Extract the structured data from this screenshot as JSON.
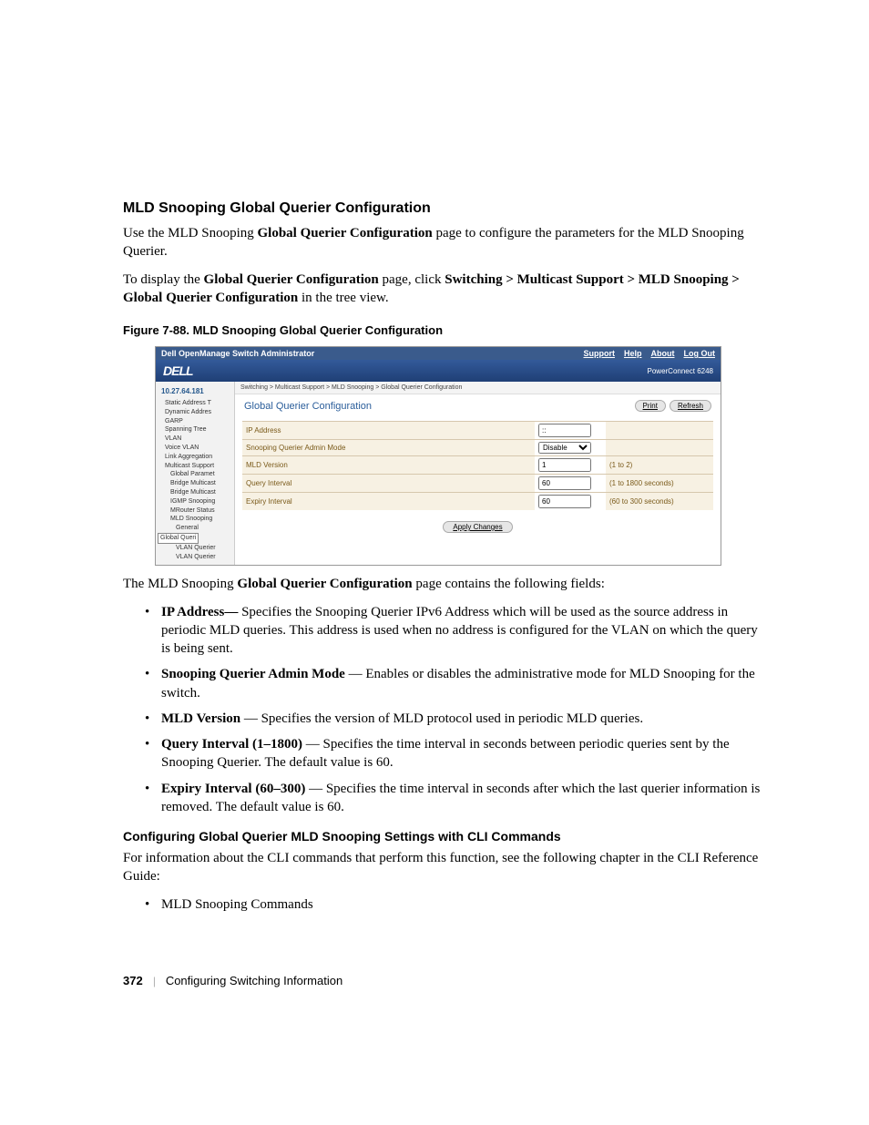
{
  "section": {
    "title": "MLD Snooping Global Querier Configuration",
    "intro_before": "Use the MLD Snooping ",
    "intro_bold": "Global Querier Configuration",
    "intro_after": " page to configure the parameters for the MLD Snooping Querier.",
    "nav_before": "To display the ",
    "nav_bold1": "Global Querier Configuration",
    "nav_mid": " page, click ",
    "nav_bold2": "Switching > Multicast Support > MLD Snooping > Global Querier Configuration",
    "nav_after": " in the tree view."
  },
  "figure": {
    "caption": "Figure 7-88.    MLD Snooping Global Querier Configuration",
    "topbar_title": "Dell OpenManage Switch Administrator",
    "nav": {
      "support": "Support",
      "help": "Help",
      "about": "About",
      "logout": "Log Out"
    },
    "brand": "DELL",
    "model": "PowerConnect 6248",
    "ip": "10.27.64.181",
    "tree": [
      {
        "t": "Static Address T",
        "c": "tn"
      },
      {
        "t": "Dynamic Addres",
        "c": "tn"
      },
      {
        "t": "GARP",
        "c": "tn"
      },
      {
        "t": "Spanning Tree",
        "c": "tn"
      },
      {
        "t": "VLAN",
        "c": "tn"
      },
      {
        "t": "Voice VLAN",
        "c": "tn"
      },
      {
        "t": "Link Aggregation",
        "c": "tn"
      },
      {
        "t": "Multicast Support",
        "c": "tn"
      },
      {
        "t": "Global Paramet",
        "c": "tn l2"
      },
      {
        "t": "Bridge Multicast",
        "c": "tn l2"
      },
      {
        "t": "Bridge Multicast",
        "c": "tn l2"
      },
      {
        "t": "IGMP Snooping",
        "c": "tn l2"
      },
      {
        "t": "MRouter Status",
        "c": "tn l2"
      },
      {
        "t": "MLD Snooping",
        "c": "tn l2"
      },
      {
        "t": "General",
        "c": "tn l3"
      },
      {
        "t": "Global Queri",
        "c": "tn l3 sel"
      },
      {
        "t": "VLAN Querier",
        "c": "tn l3"
      },
      {
        "t": "VLAN Querier",
        "c": "tn l3"
      }
    ],
    "breadcrumb": "Switching > Multicast Support > MLD Snooping > Global Querier Configuration",
    "panel_title": "Global Querier Configuration",
    "print": "Print",
    "refresh": "Refresh",
    "rows": [
      {
        "label": "IP Address",
        "value": "::",
        "range": ""
      },
      {
        "label": "Snooping Querier Admin Mode",
        "value": "Disable",
        "range": "",
        "select": true
      },
      {
        "label": "MLD Version",
        "value": "1",
        "range": "(1 to 2)"
      },
      {
        "label": "Query Interval",
        "value": "60",
        "range": "(1 to 1800 seconds)"
      },
      {
        "label": "Expiry Interval",
        "value": "60",
        "range": "(60 to 300 seconds)"
      }
    ],
    "apply": "Apply Changes"
  },
  "postfig": {
    "lead_before": "The MLD Snooping ",
    "lead_bold": "Global Querier Configuration",
    "lead_after": " page contains the following fields:",
    "items": [
      {
        "term": "IP Address—",
        "desc": " Specifies the Snooping Querier IPv6 Address which will be used as the source address in periodic MLD queries. This address is used when no address is configured for the VLAN on which the query is being sent."
      },
      {
        "term": "Snooping Querier Admin Mode",
        "desc": " — Enables or disables the administrative mode for MLD Snooping for the switch."
      },
      {
        "term": "MLD Version",
        "desc": " — Specifies the version of MLD protocol used in periodic MLD queries."
      },
      {
        "term": "Query Interval (1–1800)",
        "desc": " — Specifies the time interval in seconds between periodic queries sent by the Snooping Querier. The default value is 60."
      },
      {
        "term": "Expiry Interval (60–300)",
        "desc": " — Specifies the time interval in seconds after which the last querier information is removed. The default value is 60."
      }
    ]
  },
  "cli": {
    "title": "Configuring Global Querier MLD Snooping Settings with CLI Commands",
    "text": "For information about the CLI commands that perform this function, see the following chapter in the CLI Reference Guide:",
    "item": "MLD Snooping Commands"
  },
  "footer": {
    "page": "372",
    "chapter": "Configuring Switching Information"
  }
}
